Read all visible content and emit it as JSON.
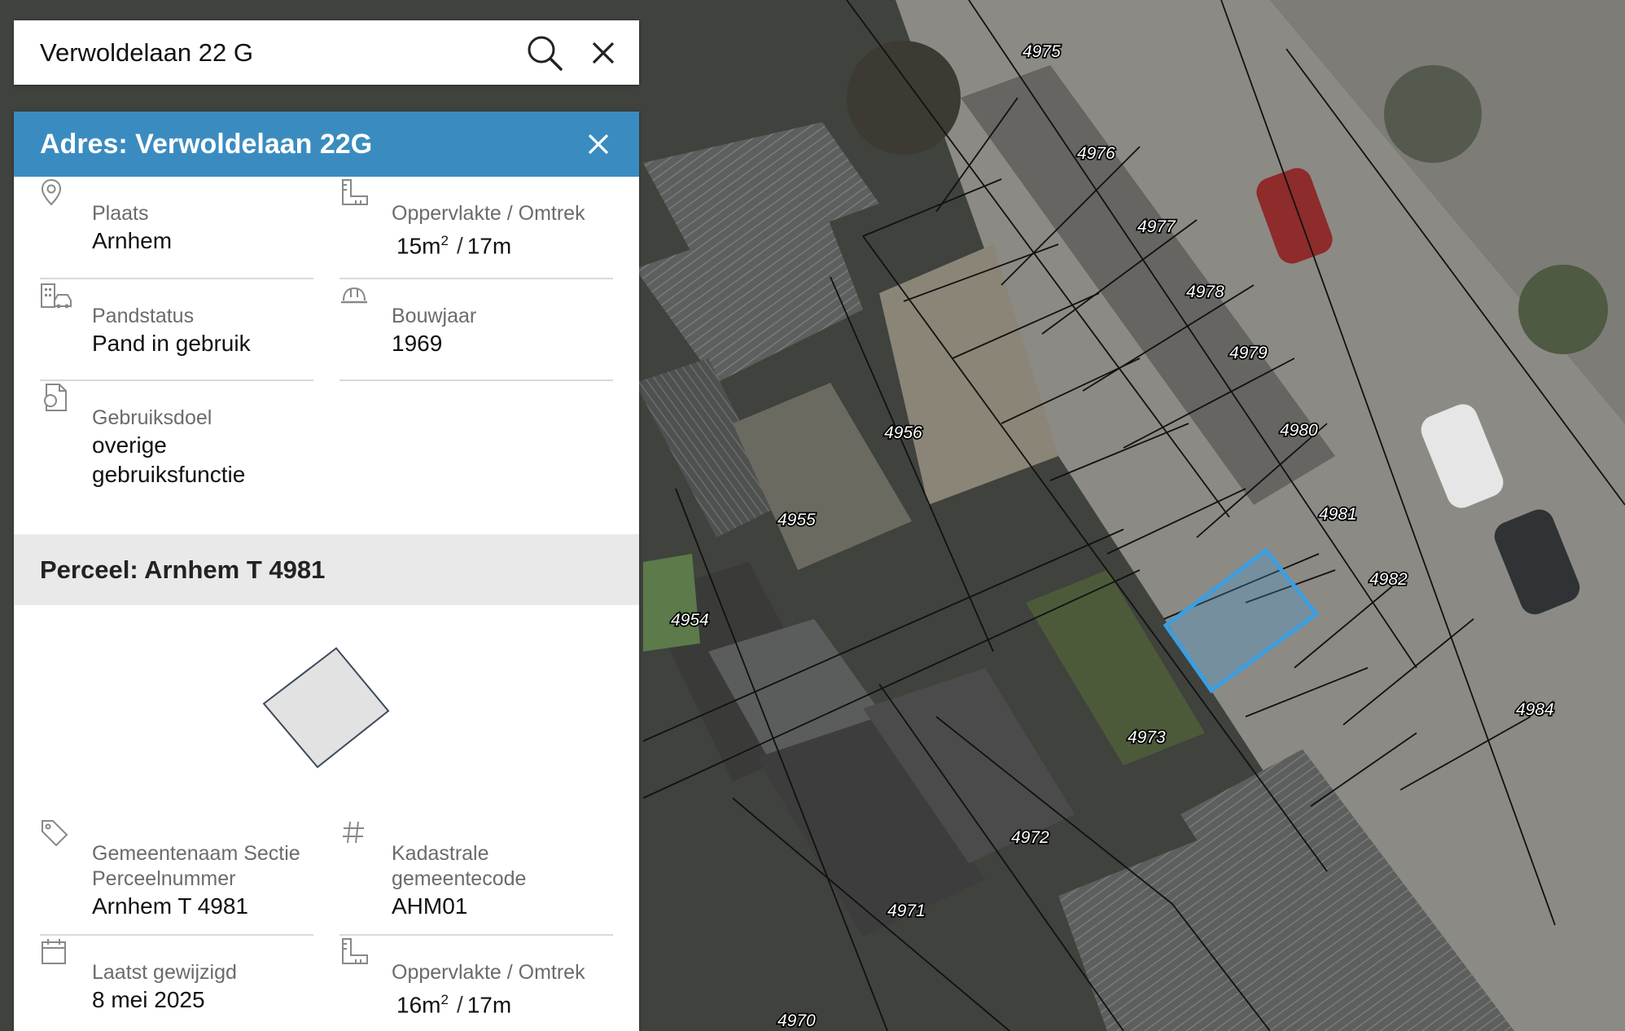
{
  "search": {
    "value": "Verwoldelaan 22 G",
    "search_icon": "search-icon",
    "close_icon": "close-icon"
  },
  "address": {
    "title": "Adres: Verwoldelaan 22G",
    "close_icon": "close-icon",
    "fields": {
      "plaats": {
        "label": "Plaats",
        "value": "Arnhem",
        "icon": "location-pin-icon"
      },
      "oppervlakte": {
        "label": "Oppervlakte / Omtrek",
        "area": "15m",
        "sup": "2",
        "sep": "/",
        "perimeter": "17m",
        "icon": "ruler-icon"
      },
      "pandstatus": {
        "label": "Pandstatus",
        "value": "Pand in gebruik",
        "icon": "building-icon"
      },
      "bouwjaar": {
        "label": "Bouwjaar",
        "value": "1969",
        "icon": "hard-hat-icon"
      },
      "gebruiksdoel": {
        "label": "Gebruiksdoel",
        "value": "overige gebruiksfunctie",
        "icon": "document-icon"
      }
    }
  },
  "parcel": {
    "title": "Perceel: Arnhem T 4981",
    "fields": {
      "gemeentenaam": {
        "label": "Gemeentenaam Sectie Perceelnummer",
        "value": "Arnhem T 4981",
        "icon": "tag-icon"
      },
      "kadastrale": {
        "label": "Kadastrale gemeentecode",
        "value": "AHM01",
        "icon": "hash-icon"
      },
      "gewijzigd": {
        "label": "Laatst gewijzigd",
        "value": "8 mei 2025",
        "icon": "calendar-icon"
      },
      "oppervlakte": {
        "label": "Oppervlakte / Omtrek",
        "area": "16m",
        "sup": "2",
        "sep": "/",
        "perimeter": "17m",
        "icon": "ruler-icon"
      }
    }
  },
  "map": {
    "parcel_numbers": [
      "4975",
      "4976",
      "4977",
      "4978",
      "4979",
      "4980",
      "4981",
      "4982",
      "4984",
      "4956",
      "4955",
      "4954",
      "4973",
      "4972",
      "4971",
      "4970"
    ],
    "highlight_color": "#3b9ee0"
  }
}
